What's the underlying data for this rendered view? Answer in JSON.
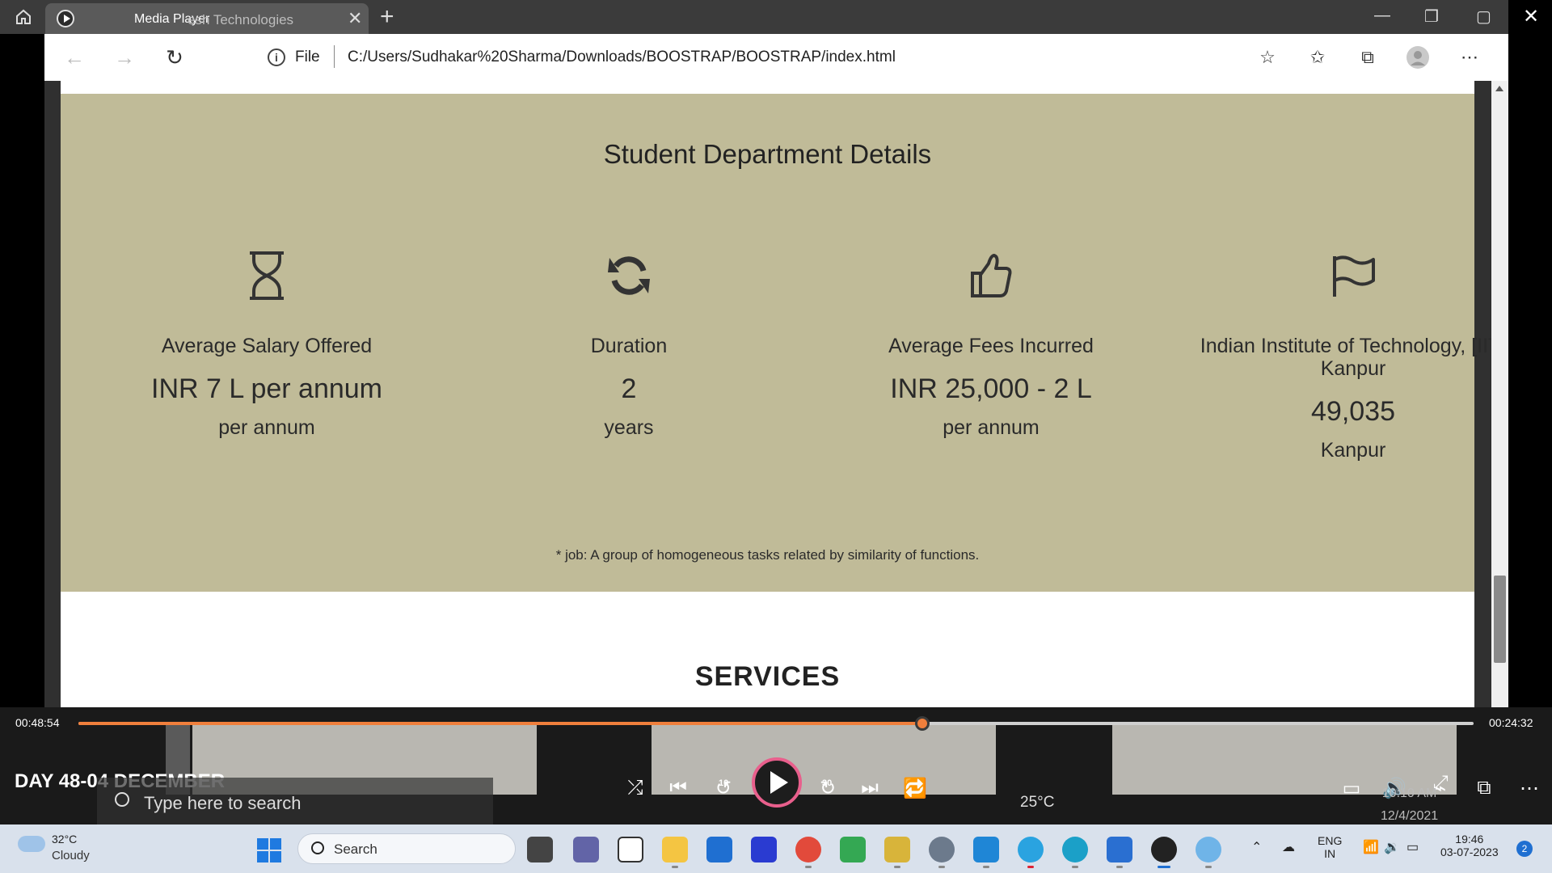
{
  "browser": {
    "media_player_label": "Media Player",
    "tab_title": "esh Technologies",
    "url_scheme": "File",
    "url_path": "C:/Users/Sudhakar%20Sharma/Downloads/BOOSTRAP/BOOSTRAP/index.html"
  },
  "dept": {
    "title": "Student Department Details",
    "stats": [
      {
        "icon": "hourglass-icon",
        "label": "Average Salary Offered",
        "value": "INR 7 L per annum",
        "unit": "per annum"
      },
      {
        "icon": "refresh-icon",
        "label": "Duration",
        "value": "2",
        "unit": "years"
      },
      {
        "icon": "thumbs-up-icon",
        "label": "Average Fees Incurred",
        "value": "INR 25,000 - 2 L",
        "unit": "per annum"
      },
      {
        "icon": "flag-icon",
        "label": "Indian Institute of Technology, [IIT] Kanpur",
        "value": "49,035",
        "unit": "Kanpur"
      }
    ],
    "footnote": "* job: A group of homogeneous tasks related by similarity of functions.",
    "bg_color": "#c0bb98"
  },
  "services": {
    "title": "SERVICES"
  },
  "player": {
    "elapsed": "00:48:54",
    "remaining": "00:24:32",
    "progress": 0.605,
    "title": "DAY 48-04 DECEMBER",
    "skip_back": "10",
    "skip_forward": "30",
    "accent": "#f07f3c"
  },
  "ghost": {
    "search_placeholder": "Type here to search",
    "temperature": "25°C",
    "time": "10:10 AM",
    "date": "12/4/2021"
  },
  "taskbar": {
    "weather_temp": "32°C",
    "weather_desc": "Cloudy",
    "search_label": "Search",
    "lang_top": "ENG",
    "lang_bottom": "IN",
    "time": "19:46",
    "date": "03-07-2023",
    "notifications": "2"
  },
  "pinned_apps": [
    "chat-icon",
    "u-app-icon",
    "file-explorer-icon",
    "mail-icon",
    "design-app-icon",
    "chrome-icon",
    "play-store-icon",
    "binance-icon",
    "settings-icon",
    "vscode-icon",
    "telegram-icon",
    "edge-icon",
    "notepad-icon",
    "media-player-icon",
    "paint-icon"
  ]
}
